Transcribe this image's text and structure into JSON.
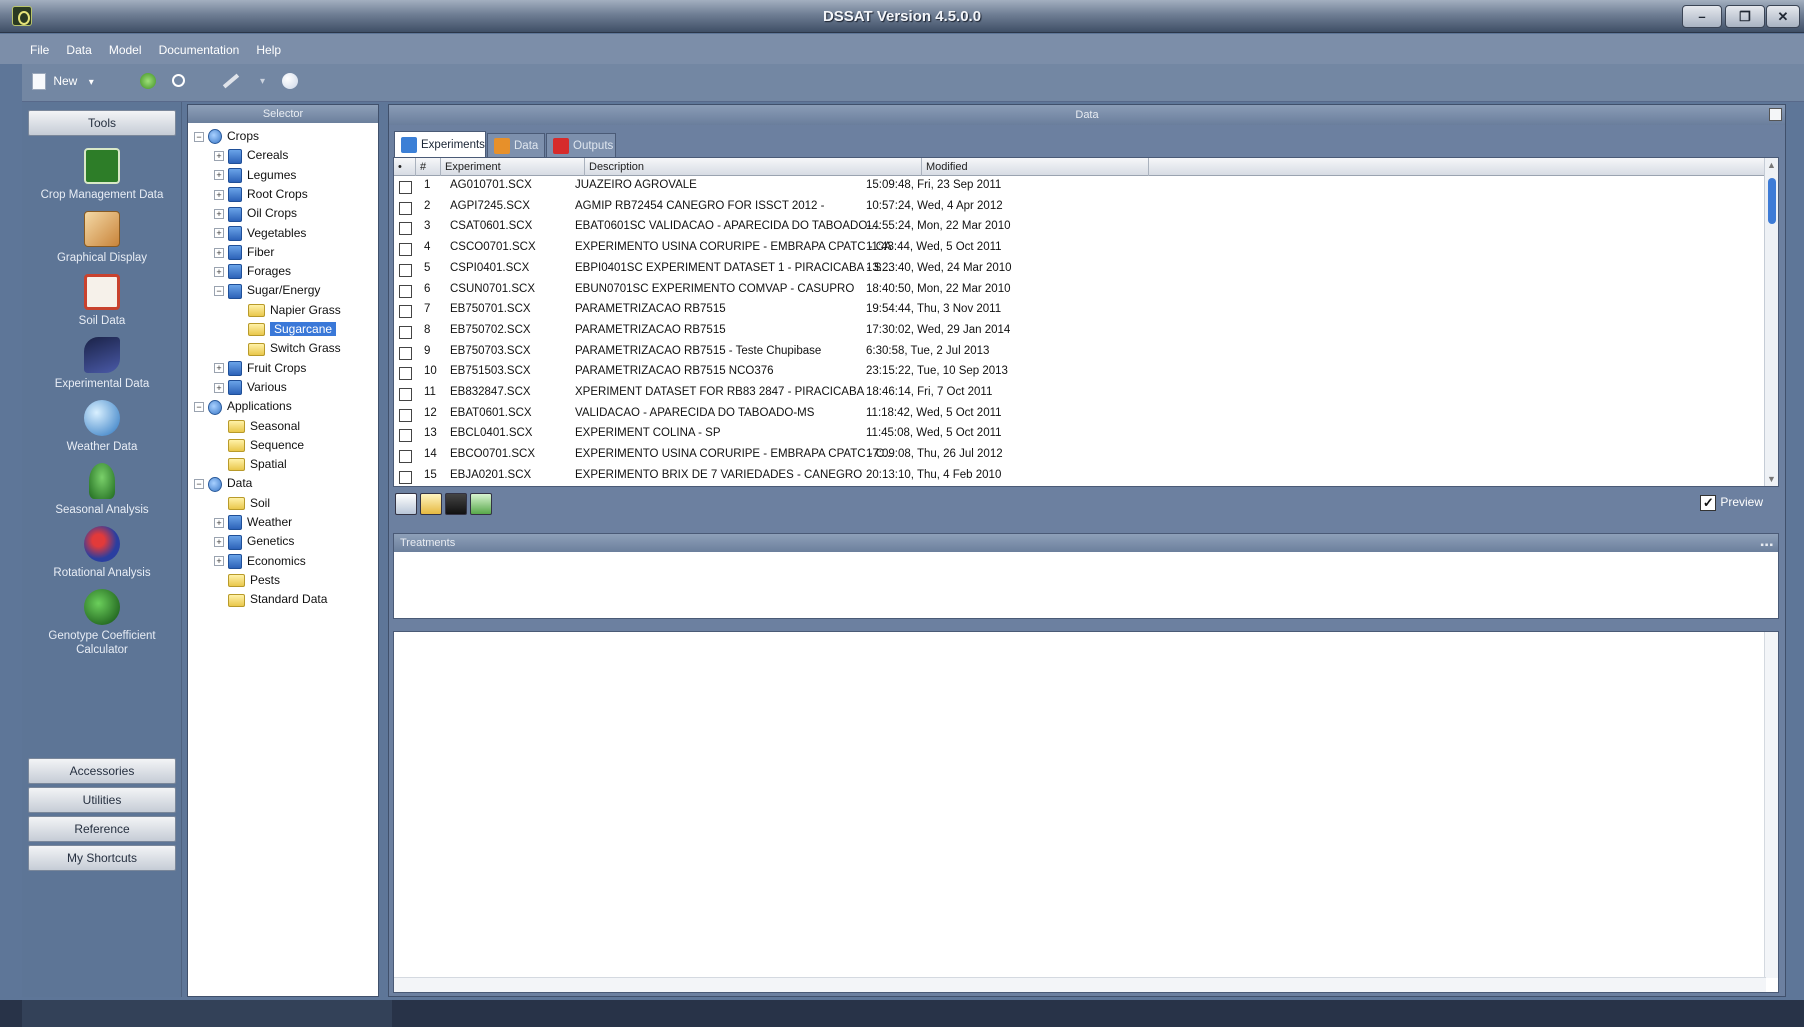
{
  "window": {
    "title": "DSSAT Version 4.5.0.0",
    "controls": {
      "minimize": "–",
      "maximize": "❐",
      "close": "✕"
    }
  },
  "menu": [
    "File",
    "Data",
    "Model",
    "Documentation",
    "Help"
  ],
  "toolbar": {
    "new_label": "New",
    "dropdown_arrow": "▾"
  },
  "tools": {
    "header": "Tools",
    "items": [
      {
        "label": "Crop Management Data",
        "icon": "crop-management-icon",
        "color": "#3a8f2e"
      },
      {
        "label": "Graphical Display",
        "icon": "graph-icon",
        "color": "#e0a94a"
      },
      {
        "label": "Soil Data",
        "icon": "soil-icon",
        "color": "#c8422e"
      },
      {
        "label": "Experimental Data",
        "icon": "telescope-icon",
        "color": "#2b3a78"
      },
      {
        "label": "Weather Data",
        "icon": "globe-icon",
        "color": "#3d8ad2"
      },
      {
        "label": "Seasonal Analysis",
        "icon": "plant-icon",
        "color": "#2f8a2a"
      },
      {
        "label": "Rotational Analysis",
        "icon": "rotation-icon",
        "color": "#2a3ea0"
      },
      {
        "label": "Genotype Coefficient Calculator",
        "icon": "genotype-icon",
        "color": "#1f7a1f"
      }
    ],
    "bottom_buttons": [
      "Accessories",
      "Utilities",
      "Reference",
      "My Shortcuts"
    ]
  },
  "selector": {
    "header": "Selector",
    "tree": [
      {
        "label": "Crops",
        "level": 0,
        "expander": "−",
        "icon": "globe"
      },
      {
        "label": "Cereals",
        "level": 1,
        "expander": "+",
        "icon": "db"
      },
      {
        "label": "Legumes",
        "level": 1,
        "expander": "+",
        "icon": "db"
      },
      {
        "label": "Root Crops",
        "level": 1,
        "expander": "+",
        "icon": "db"
      },
      {
        "label": "Oil Crops",
        "level": 1,
        "expander": "+",
        "icon": "db"
      },
      {
        "label": "Vegetables",
        "level": 1,
        "expander": "+",
        "icon": "db"
      },
      {
        "label": "Fiber",
        "level": 1,
        "expander": "+",
        "icon": "db"
      },
      {
        "label": "Forages",
        "level": 1,
        "expander": "+",
        "icon": "db"
      },
      {
        "label": "Sugar/Energy",
        "level": 1,
        "expander": "−",
        "icon": "db"
      },
      {
        "label": "Napier Grass",
        "level": 2,
        "expander": "",
        "icon": "folder"
      },
      {
        "label": "Sugarcane",
        "level": 2,
        "expander": "",
        "icon": "folder",
        "selected": true
      },
      {
        "label": "Switch Grass",
        "level": 2,
        "expander": "",
        "icon": "folder"
      },
      {
        "label": "Fruit Crops",
        "level": 1,
        "expander": "+",
        "icon": "db"
      },
      {
        "label": "Various",
        "level": 1,
        "expander": "+",
        "icon": "db"
      },
      {
        "label": "Applications",
        "level": 0,
        "expander": "−",
        "icon": "globe"
      },
      {
        "label": "Seasonal",
        "level": 1,
        "expander": "",
        "icon": "folder"
      },
      {
        "label": "Sequence",
        "level": 1,
        "expander": "",
        "icon": "folder"
      },
      {
        "label": "Spatial",
        "level": 1,
        "expander": "",
        "icon": "folder"
      },
      {
        "label": "Data",
        "level": 0,
        "expander": "−",
        "icon": "globe"
      },
      {
        "label": "Soil",
        "level": 1,
        "expander": "",
        "icon": "folder"
      },
      {
        "label": "Weather",
        "level": 1,
        "expander": "+",
        "icon": "db"
      },
      {
        "label": "Genetics",
        "level": 1,
        "expander": "+",
        "icon": "db"
      },
      {
        "label": "Economics",
        "level": 1,
        "expander": "+",
        "icon": "db"
      },
      {
        "label": "Pests",
        "level": 1,
        "expander": "",
        "icon": "folder"
      },
      {
        "label": "Standard Data",
        "level": 1,
        "expander": "",
        "icon": "folder"
      }
    ]
  },
  "data_panel": {
    "header": "Data",
    "tabs": [
      {
        "label": "Experiments",
        "active": true,
        "color": "#3b7fd6"
      },
      {
        "label": "Data",
        "active": false,
        "color": "#e7902a"
      },
      {
        "label": "Outputs",
        "active": false,
        "color": "#d62b2b"
      }
    ],
    "columns": [
      "•",
      "#",
      "Experiment",
      "Description",
      "Modified"
    ],
    "rows": [
      {
        "num": "1",
        "experiment": "AG010701.SCX",
        "description": "JUAZEIRO AGROVALE",
        "modified": "15:09:48, Fri, 23 Sep 2011"
      },
      {
        "num": "2",
        "experiment": "AGPI7245.SCX",
        "description": "AGMIP RB72454 CANEGRO FOR ISSCT 2012 -",
        "modified": "10:57:24, Wed, 4 Apr 2012"
      },
      {
        "num": "3",
        "experiment": "CSAT0601.SCX",
        "description": "EBAT0601SC VALIDACAO - APARECIDA DO TABOADO-...",
        "modified": "14:55:24, Mon, 22 Mar 2010"
      },
      {
        "num": "4",
        "experiment": "CSCO0701.SCX",
        "description": "EXPERIMENTO USINA CORURIPE - EMBRAPA CPATC - CA",
        "modified": "11:43:44, Wed, 5 Oct 2011"
      },
      {
        "num": "5",
        "experiment": "CSPI0401.SCX",
        "description": "EBPI0401SC EXPERIMENT DATASET 1 - PIRACICABA - S...",
        "modified": "13:23:40, Wed, 24 Mar 2010"
      },
      {
        "num": "6",
        "experiment": "CSUN0701.SCX",
        "description": "EBUN0701SC EXPERIMENTO COMVAP - CASUPRO",
        "modified": "18:40:50, Mon, 22 Mar 2010"
      },
      {
        "num": "7",
        "experiment": "EB750701.SCX",
        "description": "PARAMETRIZACAO RB7515",
        "modified": "19:54:44, Thu, 3 Nov 2011"
      },
      {
        "num": "8",
        "experiment": "EB750702.SCX",
        "description": "PARAMETRIZACAO RB7515",
        "modified": "17:30:02, Wed, 29 Jan 2014"
      },
      {
        "num": "9",
        "experiment": "EB750703.SCX",
        "description": "PARAMETRIZACAO RB7515 - Teste Chupibase",
        "modified": "6:30:58, Tue, 2 Jul 2013"
      },
      {
        "num": "10",
        "experiment": "EB751503.SCX",
        "description": "PARAMETRIZACAO RB7515 NCO376",
        "modified": "23:15:22, Tue, 10 Sep 2013"
      },
      {
        "num": "11",
        "experiment": "EB832847.SCX",
        "description": "XPERIMENT DATASET FOR RB83 2847 - PIRACICABA",
        "modified": "18:46:14, Fri, 7 Oct 2011"
      },
      {
        "num": "12",
        "experiment": "EBAT0601.SCX",
        "description": "VALIDACAO - APARECIDA DO TABOADO-MS",
        "modified": "11:18:42, Wed, 5 Oct 2011"
      },
      {
        "num": "13",
        "experiment": "EBCL0401.SCX",
        "description": "EXPERIMENT COLINA - SP",
        "modified": "11:45:08, Wed, 5 Oct 2011"
      },
      {
        "num": "14",
        "experiment": "EBCO0701.SCX",
        "description": "EXPERIMENTO USINA CORURIPE - EMBRAPA CPATC - C...",
        "modified": "17:09:08, Thu, 26 Jul 2012"
      },
      {
        "num": "15",
        "experiment": "EBJA0201.SCX",
        "description": "EXPERIMENTO BRIX DE 7 VARIEDADES - CANEGRO",
        "modified": "20:13:10, Thu, 4 Feb 2010"
      }
    ],
    "preview_label": "Preview",
    "preview_checked": "✓",
    "treatments_header": "Treatments"
  }
}
